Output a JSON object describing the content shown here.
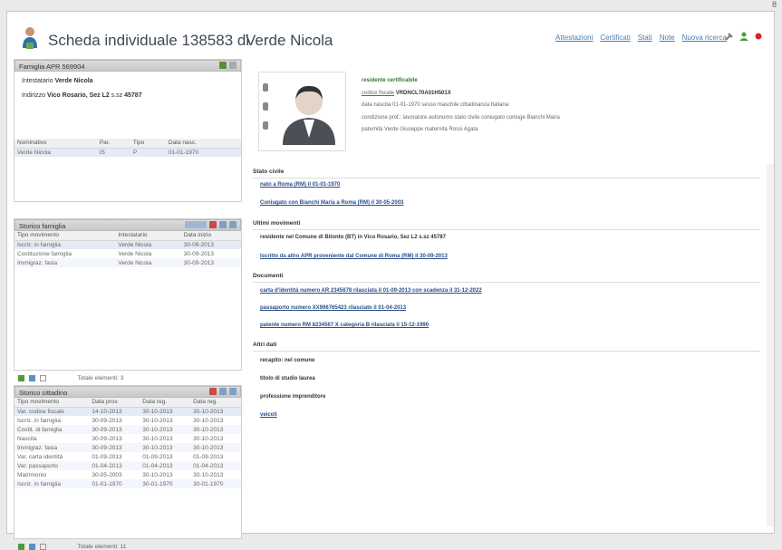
{
  "page_number": "8",
  "header": {
    "title_prefix": "Scheda individuale 138583 di",
    "person_name": "Verde Nicola",
    "links": [
      "Attestazioni",
      "Certificati",
      "Stati",
      "Note",
      "Nuova ricerca"
    ]
  },
  "famiglia": {
    "title": "Famiglia APR 569904",
    "intestatario_label": "Intestatario",
    "intestatario": "Verde Nicola",
    "indirizzo_label": "Indirizzo",
    "indirizzo": "Vico Rosario, Sez L2",
    "scala_label": "s.sz",
    "scala": "45787",
    "columns": [
      "Nominativo",
      "Par.",
      "Tipo",
      "Data nasc."
    ],
    "rows": [
      [
        "Verde Nicola",
        "IS",
        "P",
        "01-01-1970"
      ]
    ]
  },
  "storico_famiglia": {
    "title": "Storico famiglia",
    "columns": [
      "Tipo movimento",
      "Intestatario",
      "Data inizio"
    ],
    "rows": [
      [
        "Iscriz. in famiglia",
        "Verde Nicola",
        "30-09-2013"
      ],
      [
        "Costituzione famiglia",
        "Verde Nicola",
        "30-09-2013"
      ],
      [
        "Immigraz. fasia",
        "Verde Nicola",
        "30-09-2013"
      ]
    ],
    "footer": "Totale elementi: 3"
  },
  "storico_cittadino": {
    "title": "Storico cittadino",
    "columns": [
      "Tipo movimento",
      "Data prov.",
      "Data reg.",
      "Data reg."
    ],
    "rows": [
      [
        "Var. codice fiscale",
        "14-10-2013",
        "30-10-2013",
        "30-10-2013"
      ],
      [
        "Iscriz. in famiglia",
        "30-09-2013",
        "30-10-2013",
        "30-10-2013"
      ],
      [
        "Costit. di famiglia",
        "30-09-2013",
        "30-10-2013",
        "30-10-2013"
      ],
      [
        "Nascita",
        "30-09-2013",
        "30-10-2013",
        "30-10-2013"
      ],
      [
        "Immigraz. fasia",
        "30-09-2013",
        "30-10-2013",
        "30-10-2013"
      ],
      [
        "Var. carta identità",
        "01-09-2013",
        "01-09-2013",
        "01-09-2013"
      ],
      [
        "Var. passaporto",
        "01-04-2013",
        "01-04-2013",
        "01-04-2013"
      ],
      [
        "Matrimonio",
        "30-05-2003",
        "30-10-2013",
        "30-10-2013"
      ],
      [
        "Iscriz. in famiglia",
        "01-01-1970",
        "30-01-1970",
        "30-01-1970"
      ]
    ],
    "footer": "Totale elementi: 11"
  },
  "anagrafica": {
    "status": "residente certificabile",
    "codice_fiscale_label": "codice fiscale",
    "codice_fiscale": "VRDNCL70A01H501X",
    "nascita": "data nascita 01-01-1970  sesso maschile  cittadinanza Italiana",
    "condizione": "condizione prof.: lavoratore autonomo  stato civile coniugato  coniuge Bianchi Maria",
    "genitori": "paternità Verde Giuseppe  maternità Rossi Agata"
  },
  "sections": [
    {
      "title": "Stato civile",
      "rows": [
        "nato a Roma (RM) il 01-01-1970",
        "Coniugato con Bianchi Maria a Roma (RM) il 30-05-2003"
      ]
    },
    {
      "title": "Ultimi movimenti",
      "rows": [
        "residente nel Comune di Bitonto (BT) in Vico Rosario, Sez L2 s.sz 45787",
        "Iscritto da altro APR proveniente dal Comune di Roma (RM) il 30-09-2013"
      ]
    },
    {
      "title": "Documenti",
      "rows": [
        "carta d'identità numero AR 2345678 rilasciata il 01-09-2013 con scadenza il 31-12-2022",
        "passaporto numero XX996765423 rilasciato il 01-04-2013",
        "patente numero RM 8234567 X categoria B rilasciata il 15-12-1990"
      ]
    },
    {
      "title": "Altri dati",
      "rows": [
        "recapito: nel comune",
        "titolo di studio laurea",
        "professione imprenditore",
        "veicoli"
      ]
    }
  ],
  "colors": {
    "link": "#4a7fb0",
    "header_text": "#3c4a57",
    "panel_header": "#c8c8c8",
    "status_green": "#2f7a2f"
  }
}
